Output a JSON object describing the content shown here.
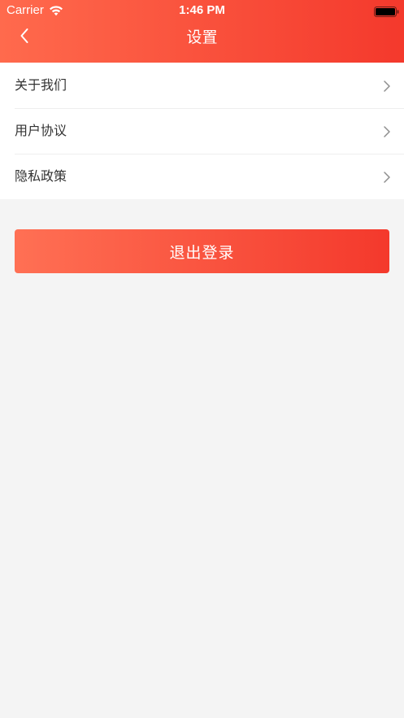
{
  "status_bar": {
    "carrier": "Carrier",
    "time": "1:46 PM",
    "wifi_icon": "wifi-icon",
    "battery_icon": "battery-icon"
  },
  "nav": {
    "title": "设置",
    "back_icon": "chevron-left-icon"
  },
  "menu": {
    "items": [
      {
        "label": "关于我们",
        "icon": "chevron-right-icon"
      },
      {
        "label": "用户协议",
        "icon": "chevron-right-icon"
      },
      {
        "label": "隐私政策",
        "icon": "chevron-right-icon"
      }
    ]
  },
  "logout": {
    "label": "退出登录"
  },
  "colors": {
    "header_gradient_start": "#ff6a4d",
    "header_gradient_end": "#f4392c",
    "background": "#f4f4f4",
    "menu_background": "#ffffff",
    "text_primary": "#333333",
    "chevron": "#8e8e8e"
  }
}
